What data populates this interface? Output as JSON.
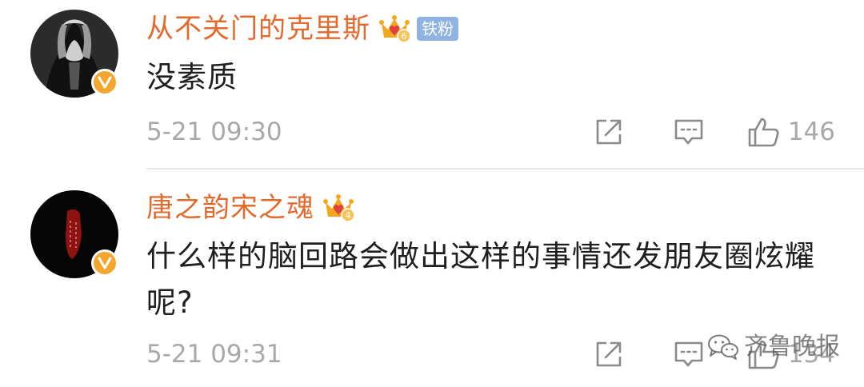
{
  "comments": [
    {
      "username": "从不关门的克里斯",
      "crown_level": "6",
      "fan_badge": "铁粉",
      "text": "没素质",
      "timestamp": "5-21 09:30",
      "like_count": "146"
    },
    {
      "username": "唐之韵宋之魂",
      "crown_level": "4",
      "text": "什么样的脑回路会做出这样的事情还发朋友圈炫耀呢?",
      "timestamp": "5-21 09:31",
      "like_count": "134"
    }
  ],
  "watermark": {
    "text": "齐鲁晚报"
  },
  "colors": {
    "username": "#e36a2d",
    "crown": "#f4a71d",
    "verified_badge": "#f3a72e",
    "fan_badge_bg": "#8fb3e3",
    "meta_gray": "#a8a8a8",
    "icon_gray": "#8a8a8a",
    "divider": "#e8e8e8"
  },
  "icons": {
    "share": "share-icon",
    "reply": "comment-icon",
    "like": "thumbs-up-icon",
    "verified": "verified-v-icon",
    "crown": "crown-icon",
    "watermark": "wechat-icon"
  }
}
